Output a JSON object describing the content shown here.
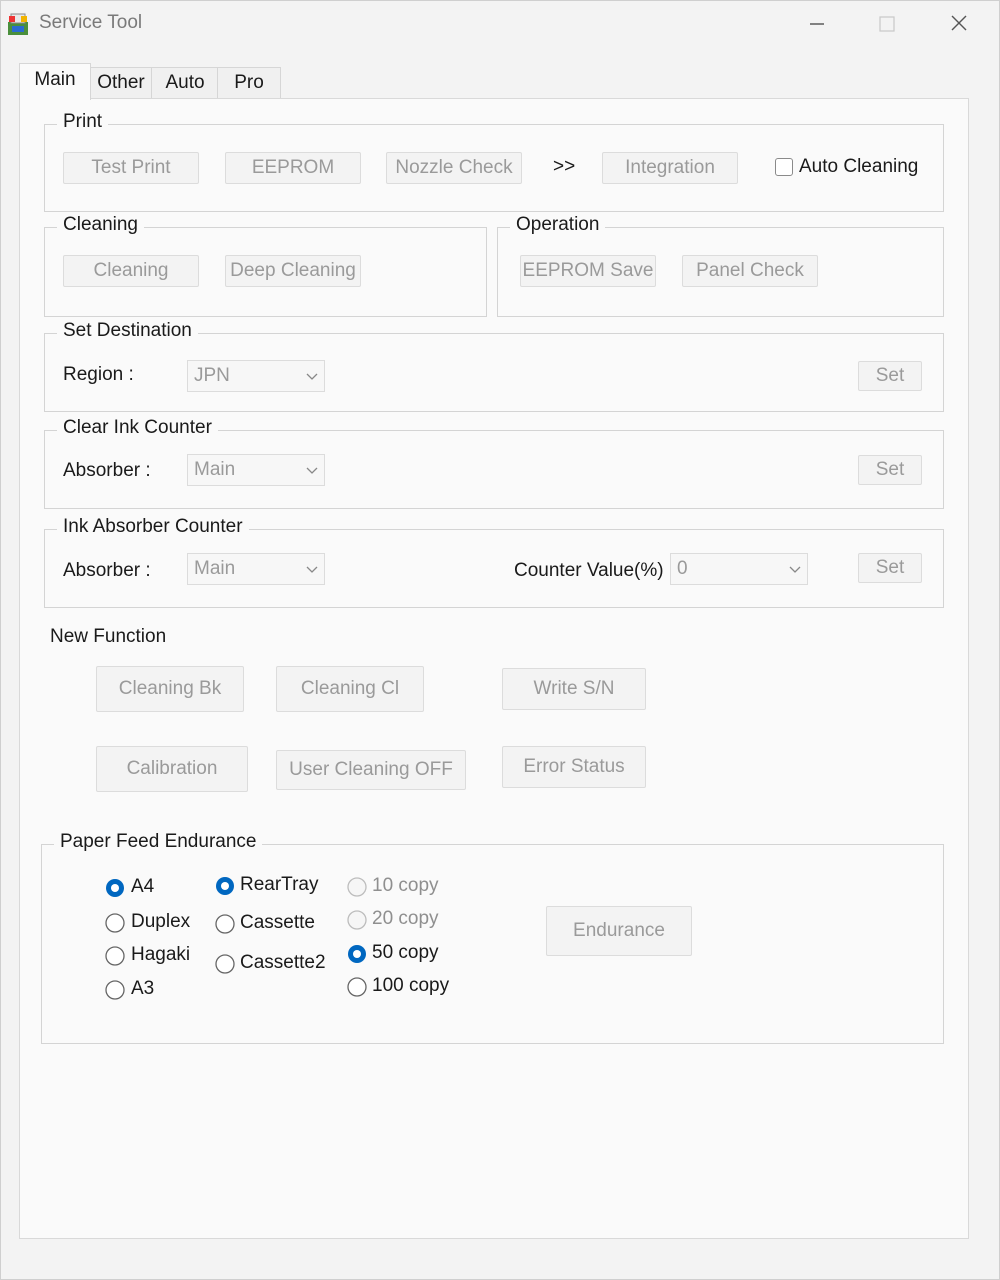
{
  "window": {
    "title": "Service Tool",
    "icon": "printer-app-icon",
    "controls": [
      "minimize-icon",
      "maximize-icon",
      "close-icon"
    ]
  },
  "tabs": [
    {
      "label": "Main",
      "active": true
    },
    {
      "label": "Other",
      "active": false
    },
    {
      "label": "Auto",
      "active": false
    },
    {
      "label": "Pro",
      "active": false
    }
  ],
  "print_group": {
    "label": "Print",
    "test_print": "Test Print",
    "eeprom": "EEPROM",
    "nozzle_check": "Nozzle Check",
    "arrow": ">>",
    "integration": "Integration",
    "auto_cleaning": "Auto Cleaning",
    "auto_cleaning_checked": false
  },
  "cleaning_group": {
    "label": "Cleaning",
    "cleaning": "Cleaning",
    "deep_cleaning": "Deep Cleaning"
  },
  "operation_group": {
    "label": "Operation",
    "eeprom_save": "EEPROM Save",
    "panel_check": "Panel Check"
  },
  "set_destination": {
    "label": "Set Destination",
    "region_label": "Region :",
    "region_value": "JPN",
    "set": "Set"
  },
  "clear_ink_counter": {
    "label": "Clear Ink Counter",
    "absorber_label": "Absorber :",
    "absorber_value": "Main",
    "set": "Set"
  },
  "ink_absorber_counter": {
    "label": "Ink Absorber Counter",
    "absorber_label": "Absorber :",
    "absorber_value": "Main",
    "counter_label": "Counter Value(%) :",
    "counter_value": "0",
    "set": "Set"
  },
  "new_function": {
    "label": "New Function",
    "cleaning_bk": "Cleaning Bk",
    "cleaning_cl": "Cleaning Cl",
    "write_sn": "Write S/N",
    "calibration": "Calibration",
    "user_cleaning_off": "User Cleaning OFF",
    "error_status": "Error Status"
  },
  "paper_feed": {
    "label": "Paper Feed Endurance",
    "sizes": [
      {
        "label": "A4",
        "selected": true
      },
      {
        "label": "Duplex",
        "selected": false
      },
      {
        "label": "Hagaki",
        "selected": false
      },
      {
        "label": "A3",
        "selected": false
      }
    ],
    "sources": [
      {
        "label": "RearTray",
        "selected": true
      },
      {
        "label": "Cassette",
        "selected": false
      },
      {
        "label": "Cassette2",
        "selected": false
      }
    ],
    "copies": [
      {
        "label": "10 copy",
        "selected": false,
        "enabled": false
      },
      {
        "label": "20 copy",
        "selected": false,
        "enabled": false
      },
      {
        "label": "50 copy",
        "selected": true,
        "enabled": true
      },
      {
        "label": "100 copy",
        "selected": false,
        "enabled": true
      }
    ],
    "endurance": "Endurance"
  },
  "colors": {
    "radio_selected": "#0067c0",
    "disabled_text": "#9a9a9a"
  }
}
